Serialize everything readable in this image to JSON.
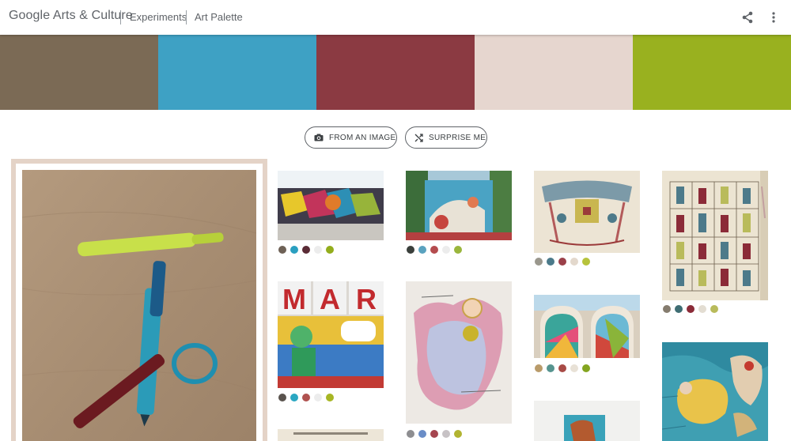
{
  "header": {
    "brand": "Google Arts & Culture",
    "breadcrumb": [
      "Experiments",
      "Art Palette"
    ]
  },
  "palette": [
    "#7b6a55",
    "#3ea1c4",
    "#8b3a42",
    "#e6d6cf",
    "#99b11f"
  ],
  "buttons": {
    "from_image": "FROM AN IMAGE",
    "surprise": "SURPRISE ME"
  },
  "results": [
    {
      "colors": [
        "#6e6156",
        "#2a9fc0",
        "#5a2b35",
        "#ececec",
        "#93ad1c"
      ]
    },
    {
      "colors": [
        "#3a3f3b",
        "#5aa2bf",
        "#b44b4e",
        "#ececec",
        "#9ab63c"
      ]
    },
    {
      "colors": [
        "#9a978d",
        "#4b7a8a",
        "#9b4049",
        "#e3d8cc",
        "#b7c33c"
      ]
    },
    {
      "colors": [
        "#857c6e",
        "#3f6d73",
        "#8b2b38",
        "#e3ddd2",
        "#b9bb5b"
      ]
    },
    {
      "colors": [
        "#5a534e",
        "#2aa7c2",
        "#b0524f",
        "#ececec",
        "#a7b624"
      ]
    },
    {
      "colors": [
        "#8e8e91",
        "#6a8dc7",
        "#a5454f",
        "#c7c2c5",
        "#b2b431"
      ]
    },
    {
      "colors": [
        "#b99b6a",
        "#56948f",
        "#a84b46",
        "#e8e1d6",
        "#84a520"
      ]
    },
    {
      "colors": []
    },
    {
      "colors": []
    },
    {
      "colors": []
    }
  ]
}
